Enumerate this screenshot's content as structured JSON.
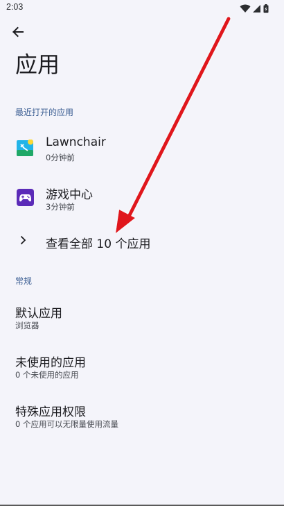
{
  "status_bar": {
    "time": "2:03",
    "icons": [
      "wifi-icon",
      "signal-icon",
      "battery-icon"
    ]
  },
  "header": {
    "back_icon": "arrow-back-icon",
    "title": "应用"
  },
  "recent": {
    "section_title": "最近打开的应用",
    "apps": [
      {
        "name": "Lawnchair",
        "subtitle": "0分钟前",
        "icon": "lawnchair-icon"
      },
      {
        "name": "游戏中心",
        "subtitle": "3分钟前",
        "icon": "game-center-icon"
      }
    ],
    "see_all_label": "查看全部 10 个应用",
    "see_all_icon": "chevron-right-icon"
  },
  "general": {
    "section_title": "常规",
    "items": [
      {
        "title": "默认应用",
        "subtitle": "浏览器"
      },
      {
        "title": "未使用的应用",
        "subtitle": "0 个未使用的应用"
      },
      {
        "title": "特殊应用权限",
        "subtitle": "0 个应用可以无限量使用流量"
      }
    ]
  },
  "colors": {
    "background": "#f4f4fa",
    "accent": "#3a5d92",
    "annotation_arrow": "#e0161d"
  }
}
